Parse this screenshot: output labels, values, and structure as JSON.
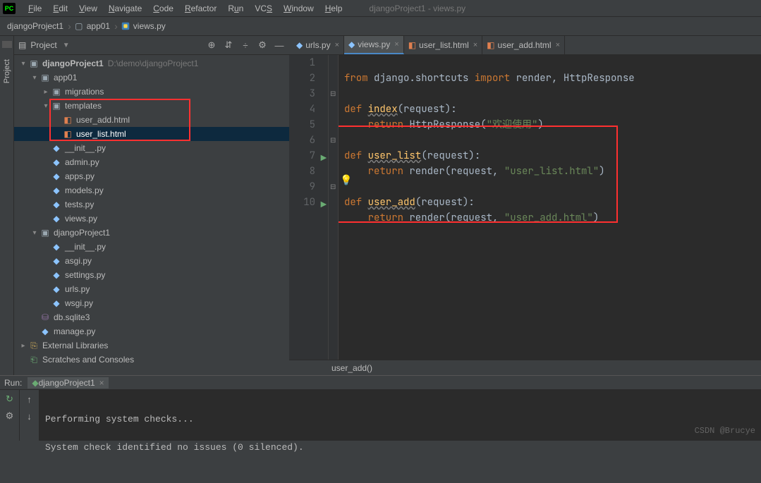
{
  "menu": {
    "items": [
      "File",
      "Edit",
      "View",
      "Navigate",
      "Code",
      "Refactor",
      "Run",
      "VCS",
      "Window",
      "Help"
    ],
    "app_title": "djangoProject1 - views.py"
  },
  "breadcrumbs": {
    "c1": "djangoProject1",
    "c2": "app01",
    "c3": "views.py"
  },
  "project_panel": {
    "title": "Project"
  },
  "tree": {
    "root_name": "djangoProject1",
    "root_path": "D:\\demo\\djangoProject1",
    "app01": "app01",
    "migrations": "migrations",
    "templates": "templates",
    "user_add": "user_add.html",
    "user_list": "user_list.html",
    "init": "__init__.py",
    "admin": "admin.py",
    "apps": "apps.py",
    "models": "models.py",
    "tests": "tests.py",
    "views": "views.py",
    "project": "djangoProject1",
    "p_init": "__init__.py",
    "asgi": "asgi.py",
    "settings": "settings.py",
    "urls": "urls.py",
    "wsgi": "wsgi.py",
    "db": "db.sqlite3",
    "manage": "manage.py",
    "ext_lib": "External Libraries",
    "scratches": "Scratches and Consoles"
  },
  "tabs": {
    "t1": "urls.py",
    "t2": "views.py",
    "t3": "user_list.html",
    "t4": "user_add.html"
  },
  "code": {
    "l1a": "from",
    "l1b": " django.shortcuts ",
    "l1c": "import",
    "l1d": " render, HttpResponse",
    "l3a": "def ",
    "l3b": "index",
    "l3c": "(request):",
    "l4a": "    return ",
    "l4b": "HttpResponse(",
    "l4c": "\"欢迎使用\"",
    "l4d": ")",
    "l6a": "def ",
    "l6b": "user_list",
    "l6c": "(request):",
    "l7a": "    return ",
    "l7b": "render(request, ",
    "l7c": "\"user_list.html\"",
    "l7d": ")",
    "l9a": "def ",
    "l9b": "user_add",
    "l9c": "(request):",
    "l10a": "    return ",
    "l10b": "render(request, ",
    "l10c": "\"user_add.html\"",
    "l10d": ")"
  },
  "lines": [
    "1",
    "2",
    "3",
    "4",
    "5",
    "6",
    "7",
    "8",
    "9",
    "10"
  ],
  "crumb_bottom": "user_add()",
  "run": {
    "label": "Run:",
    "config": "djangoProject1",
    "out1": "Performing system checks...",
    "out2": "System check identified no issues (0 silenced)."
  },
  "watermark": "CSDN @Brucye"
}
